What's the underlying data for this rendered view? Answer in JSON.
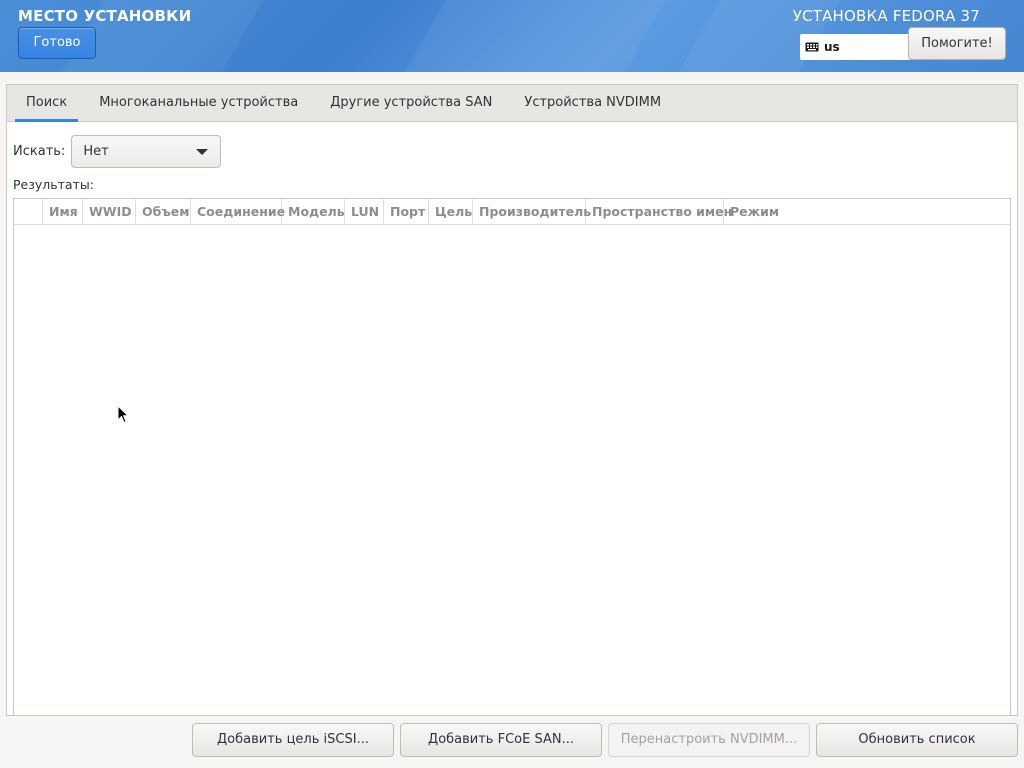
{
  "header": {
    "spoke_title": "МЕСТО УСТАНОВКИ",
    "done_label": "Готово",
    "product_title": "УСТАНОВКА FEDORA 37",
    "keyboard_layout": "us",
    "help_label": "Помогите!"
  },
  "tabs": [
    {
      "label": "Поиск",
      "active": true
    },
    {
      "label": "Многоканальные устройства",
      "active": false
    },
    {
      "label": "Другие устройства SAN",
      "active": false
    },
    {
      "label": "Устройства NVDIMM",
      "active": false
    }
  ],
  "search": {
    "label": "Искать:",
    "selected": "Нет"
  },
  "results": {
    "label": "Результаты:",
    "columns": [
      "",
      "Имя",
      "WWID",
      "Объем",
      "Соединение",
      "Модель",
      "LUN",
      "Порт",
      "Цель",
      "Производитель",
      "Пространство имен",
      "Режим"
    ],
    "rows": []
  },
  "buttons": {
    "add_iscsi": "Добавить цель iSCSI...",
    "add_fcoe": "Добавить FCoE SAN...",
    "reconfigure_nvdimm": "Перенастроить NVDIMM...",
    "refresh": "Обновить список"
  },
  "colors": {
    "accent": "#3584e4",
    "header_bg": "#4a8fd6"
  }
}
